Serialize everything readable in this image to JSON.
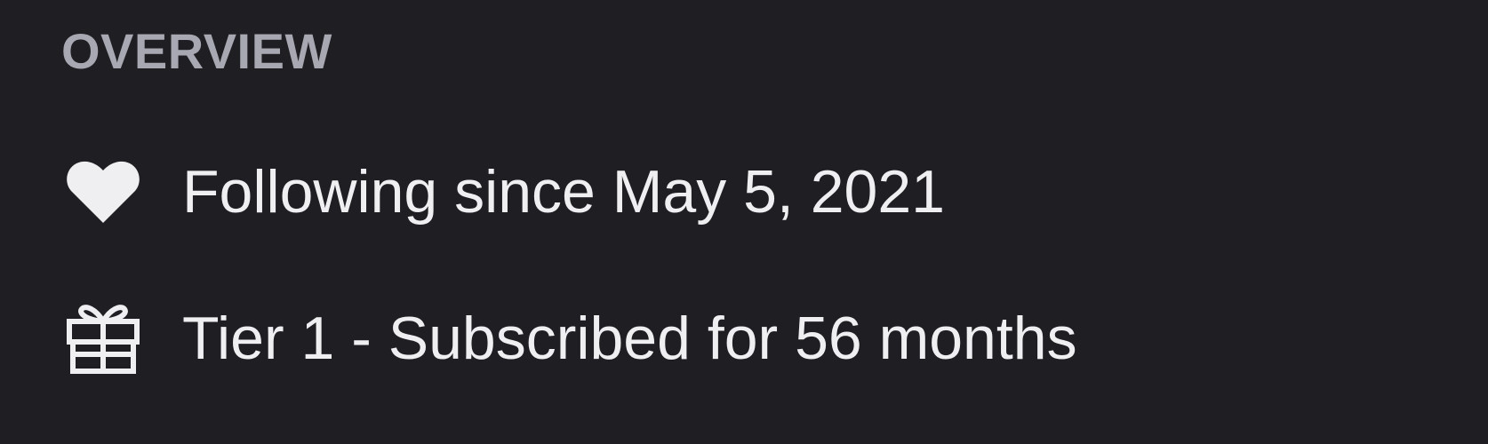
{
  "overview": {
    "title": "OVERVIEW",
    "rows": [
      {
        "icon": "heart-icon",
        "text": "Following since May 5, 2021"
      },
      {
        "icon": "gift-icon",
        "text": "Tier 1 - Subscribed for 56 months"
      }
    ]
  },
  "colors": {
    "background": "#1f1e23",
    "title": "#a8a8b2",
    "text": "#efeff1",
    "icon": "#efeff1"
  }
}
